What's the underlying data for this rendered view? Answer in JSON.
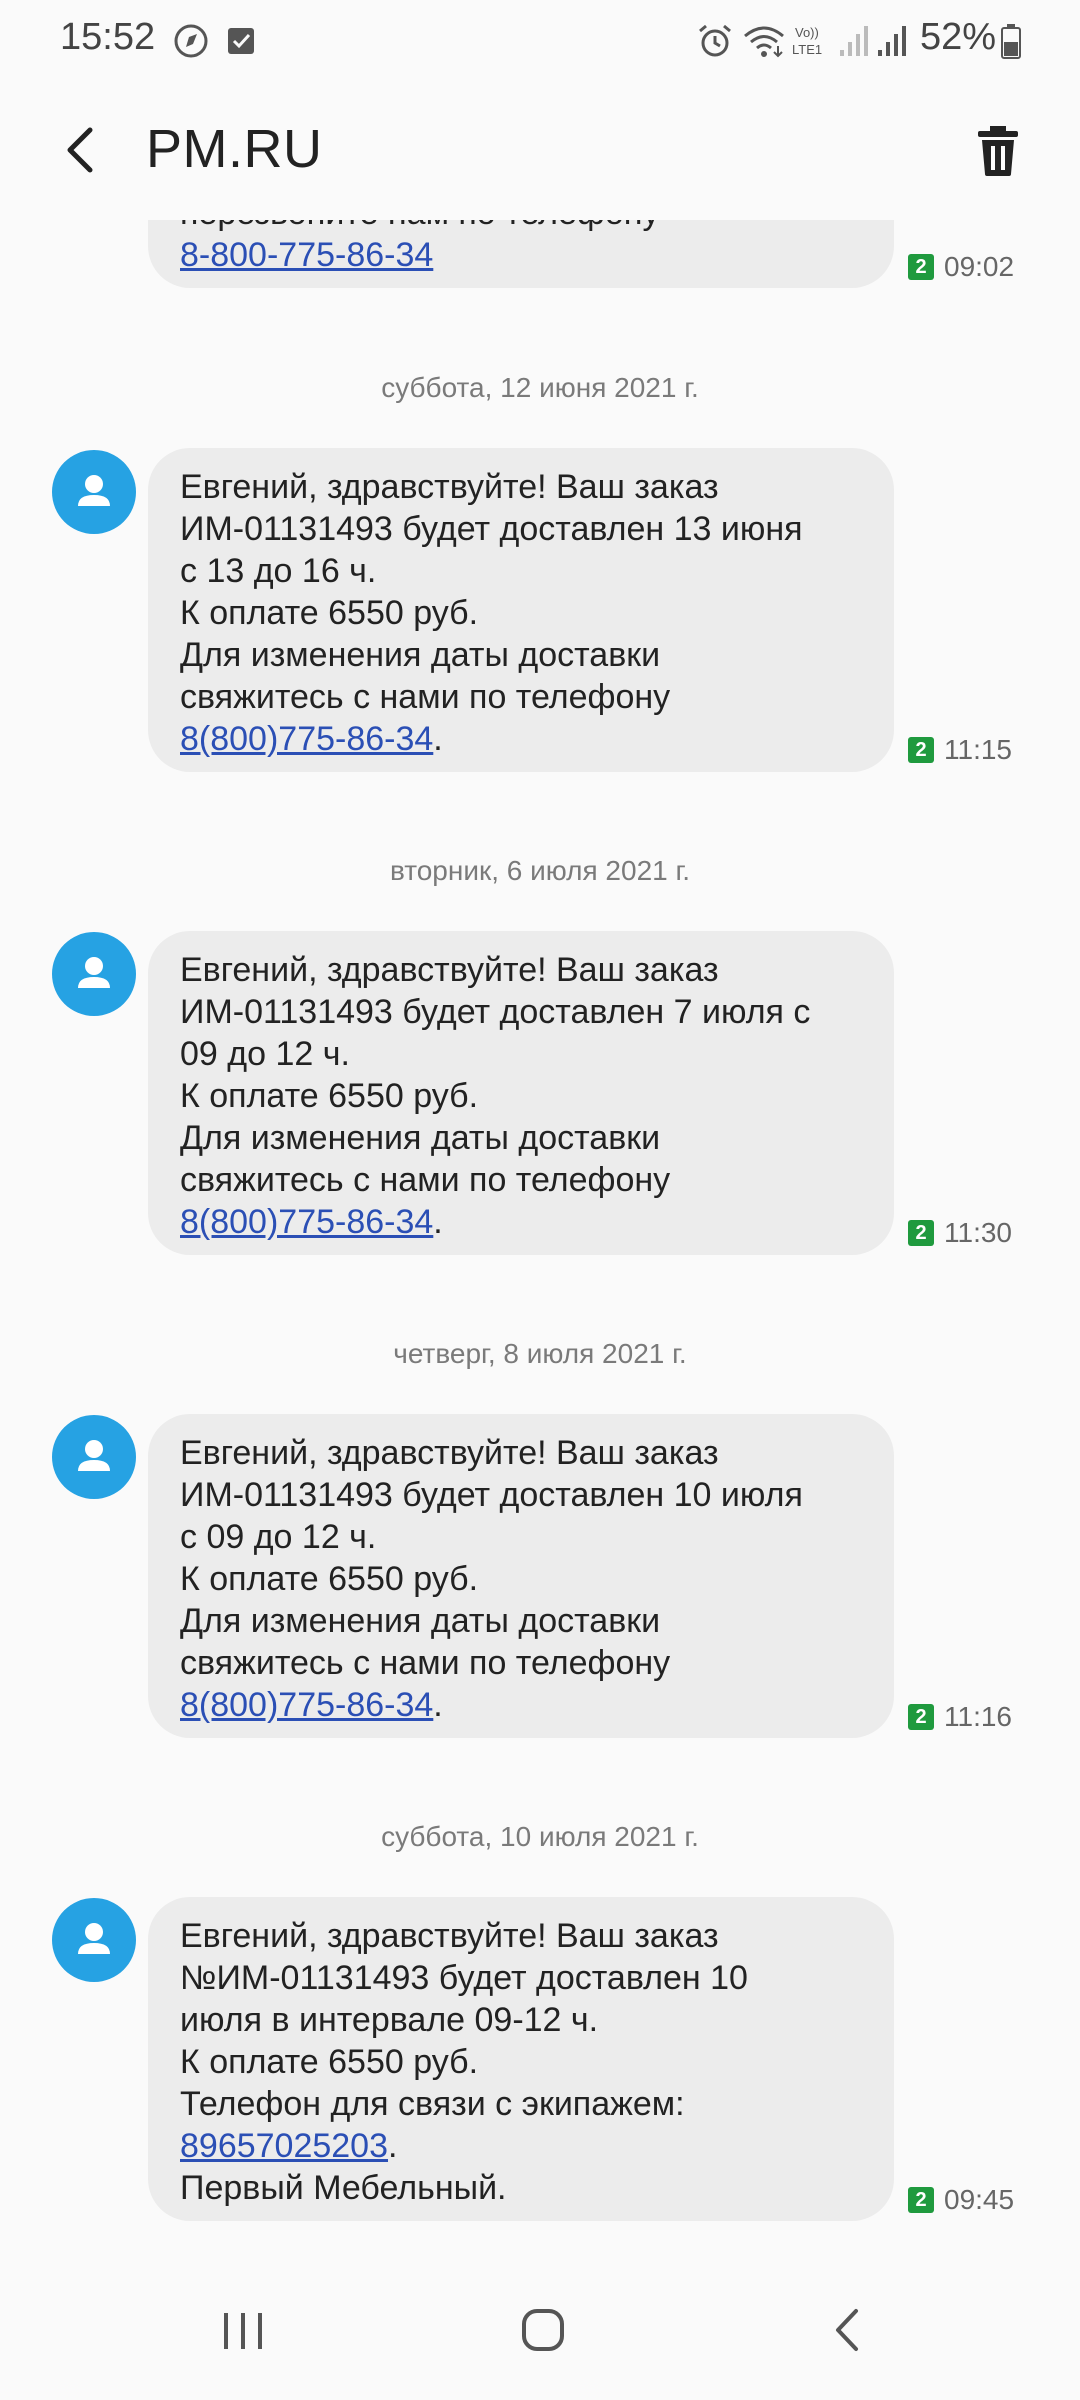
{
  "status_bar": {
    "time": "15:52",
    "battery": "52%",
    "icons": [
      "media-player-icon",
      "checkbox-notification-icon",
      "alarm-icon",
      "wifi-icon",
      "volte-lte-icon",
      "signal-icon",
      "battery-icon"
    ]
  },
  "app_bar": {
    "title": "PM.RU",
    "back_icon": "back-arrow-icon",
    "delete_icon": "trash-icon"
  },
  "conversation": {
    "messages": [
      {
        "date": "",
        "lines": [
          "перезвоните нам по телефону"
        ],
        "link": "8-800-775-86-34",
        "link_suffix": "",
        "tail": "",
        "sim": "2",
        "time": "09:02"
      },
      {
        "date": "суббота, 12 июня 2021 г.",
        "lines": [
          "Евгений, здравствуйте! Ваш заказ",
          "ИМ-01131493 будет доставлен 13 июня",
          "с 13 до 16 ч.",
          "К оплате 6550 руб.",
          "Для изменения даты доставки",
          "свяжитесь с нами по телефону"
        ],
        "link": "8(800)775-86-34",
        "link_suffix": ".",
        "tail": "",
        "sim": "2",
        "time": "11:15"
      },
      {
        "date": "вторник, 6 июля 2021 г.",
        "lines": [
          "Евгений, здравствуйте! Ваш заказ",
          "ИМ-01131493 будет доставлен 7 июля с",
          "09 до 12 ч.",
          "К оплате 6550 руб.",
          "Для изменения даты доставки",
          "свяжитесь с нами по телефону"
        ],
        "link": "8(800)775-86-34",
        "link_suffix": ".",
        "tail": "",
        "sim": "2",
        "time": "11:30"
      },
      {
        "date": "четверг, 8 июля 2021 г.",
        "lines": [
          "Евгений, здравствуйте! Ваш заказ",
          "ИМ-01131493 будет доставлен 10 июля",
          "с 09 до 12 ч.",
          "К оплате 6550 руб.",
          "Для изменения даты доставки",
          "свяжитесь с нами по телефону"
        ],
        "link": "8(800)775-86-34",
        "link_suffix": ".",
        "tail": "",
        "sim": "2",
        "time": "11:16"
      },
      {
        "date": "суббота, 10 июля 2021 г.",
        "lines": [
          "Евгений, здравствуйте! Ваш заказ",
          "№ИМ-01131493 будет доставлен 10",
          "июля в интервале 09-12 ч.",
          "К оплате 6550 руб.",
          "Телефон для связи с экипажем:"
        ],
        "link": "89657025203",
        "link_suffix": ".",
        "tail": "Первый Мебельный.",
        "sim": "2",
        "time": "09:45"
      }
    ]
  },
  "nav_bar": {
    "icons": [
      "recent-apps-icon",
      "home-icon",
      "back-icon"
    ]
  },
  "colors": {
    "accent_avatar": "#26a2e3",
    "bubble": "#ececec",
    "link": "#2b4fb5",
    "sim_badge": "#1f9a3e"
  }
}
